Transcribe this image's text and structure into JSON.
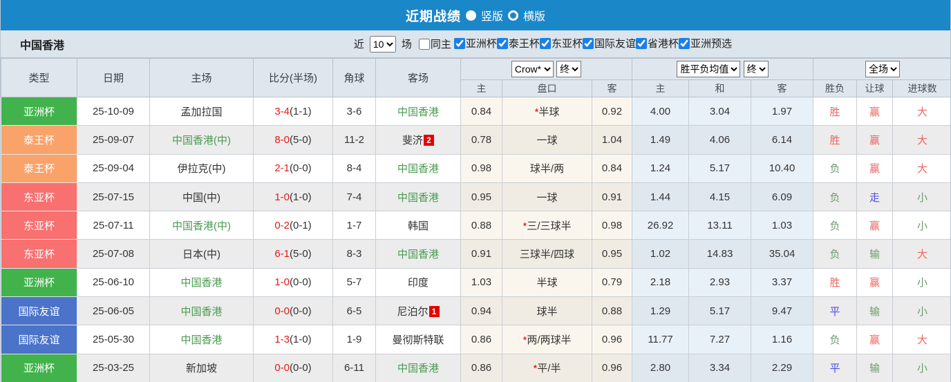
{
  "title_bar": {
    "title": "近期战绩",
    "radios": [
      {
        "label": "竖版",
        "selected": true
      },
      {
        "label": "横版",
        "selected": false
      }
    ]
  },
  "filter": {
    "team": "中国香港",
    "near_label": "近",
    "match_count": "10",
    "matches_label": "场",
    "same_home": {
      "label": "同主",
      "checked": false
    },
    "competitions": [
      {
        "label": "亚洲杯",
        "checked": true
      },
      {
        "label": "泰王杯",
        "checked": true
      },
      {
        "label": "东亚杯",
        "checked": true
      },
      {
        "label": "国际友谊",
        "checked": true
      },
      {
        "label": "省港杯",
        "checked": true
      },
      {
        "label": "亚洲预选",
        "checked": true
      }
    ]
  },
  "table": {
    "headers": {
      "type": "类型",
      "date": "日期",
      "home": "主场",
      "score": "比分(半场)",
      "corners": "角球",
      "away": "客场"
    },
    "selects": {
      "odds_source": "Crow*",
      "odds_time": "终",
      "avg_source": "胜平负均值",
      "avg_time": "终",
      "scope": "全场"
    },
    "sub_headers": {
      "odds_home": "主",
      "odds_line": "盘口",
      "odds_away": "客",
      "avg_home": "主",
      "avg_draw": "和",
      "avg_away": "客",
      "outcome": "胜负",
      "handicap": "让球",
      "goals": "进球数"
    },
    "highlight_team": "中国香港",
    "type_colors": {
      "亚洲杯": "#42b34c",
      "泰王杯": "#f9a36b",
      "东亚杯": "#f97070",
      "国际友谊": "#4a73c9"
    },
    "result_colors": {
      "胜": "red",
      "负": "green",
      "平": "blue",
      "赢": "red",
      "输": "green",
      "走": "blue",
      "大": "red",
      "小": "green"
    },
    "rows": [
      {
        "type": "亚洲杯",
        "date": "25-10-09",
        "home": "孟加拉国",
        "score_ft": "3-4",
        "score_ht": "(1-1)",
        "corners": "3-6",
        "away": "中国香港",
        "away_badge": "",
        "odds_home": "0.84",
        "line": "*半球",
        "odds_away": "0.92",
        "avg_home": "4.00",
        "avg_draw": "3.04",
        "avg_away": "1.97",
        "outcome": "胜",
        "handicap": "赢",
        "goals": "大"
      },
      {
        "type": "泰王杯",
        "date": "25-09-07",
        "home": "中国香港(中)",
        "score_ft": "8-0",
        "score_ht": "(5-0)",
        "corners": "11-2",
        "away": "斐济",
        "away_badge": "2",
        "odds_home": "0.78",
        "line": "一球",
        "odds_away": "1.04",
        "avg_home": "1.49",
        "avg_draw": "4.06",
        "avg_away": "6.14",
        "outcome": "胜",
        "handicap": "赢",
        "goals": "大"
      },
      {
        "type": "泰王杯",
        "date": "25-09-04",
        "home": "伊拉克(中)",
        "score_ft": "2-1",
        "score_ht": "(0-0)",
        "corners": "8-4",
        "away": "中国香港",
        "away_badge": "",
        "odds_home": "0.98",
        "line": "球半/两",
        "odds_away": "0.84",
        "avg_home": "1.24",
        "avg_draw": "5.17",
        "avg_away": "10.40",
        "outcome": "负",
        "handicap": "赢",
        "goals": "大"
      },
      {
        "type": "东亚杯",
        "date": "25-07-15",
        "home": "中国(中)",
        "score_ft": "1-0",
        "score_ht": "(1-0)",
        "corners": "7-4",
        "away": "中国香港",
        "away_badge": "",
        "odds_home": "0.95",
        "line": "一球",
        "odds_away": "0.91",
        "avg_home": "1.44",
        "avg_draw": "4.15",
        "avg_away": "6.09",
        "outcome": "负",
        "handicap": "走",
        "goals": "小"
      },
      {
        "type": "东亚杯",
        "date": "25-07-11",
        "home": "中国香港(中)",
        "score_ft": "0-2",
        "score_ht": "(0-1)",
        "corners": "1-7",
        "away": "韩国",
        "away_badge": "",
        "odds_home": "0.88",
        "line": "*三/三球半",
        "odds_away": "0.98",
        "avg_home": "26.92",
        "avg_draw": "13.11",
        "avg_away": "1.03",
        "outcome": "负",
        "handicap": "赢",
        "goals": "小"
      },
      {
        "type": "东亚杯",
        "date": "25-07-08",
        "home": "日本(中)",
        "score_ft": "6-1",
        "score_ht": "(5-0)",
        "corners": "8-3",
        "away": "中国香港",
        "away_badge": "",
        "odds_home": "0.91",
        "line": "三球半/四球",
        "odds_away": "0.95",
        "avg_home": "1.02",
        "avg_draw": "14.83",
        "avg_away": "35.04",
        "outcome": "负",
        "handicap": "输",
        "goals": "大"
      },
      {
        "type": "亚洲杯",
        "date": "25-06-10",
        "home": "中国香港",
        "score_ft": "1-0",
        "score_ht": "(0-0)",
        "corners": "5-7",
        "away": "印度",
        "away_badge": "",
        "odds_home": "1.03",
        "line": "半球",
        "odds_away": "0.79",
        "avg_home": "2.18",
        "avg_draw": "2.93",
        "avg_away": "3.37",
        "outcome": "胜",
        "handicap": "赢",
        "goals": "小"
      },
      {
        "type": "国际友谊",
        "date": "25-06-05",
        "home": "中国香港",
        "score_ft": "0-0",
        "score_ht": "(0-0)",
        "corners": "6-5",
        "away": "尼泊尔",
        "away_badge": "1",
        "odds_home": "0.94",
        "line": "球半",
        "odds_away": "0.88",
        "avg_home": "1.29",
        "avg_draw": "5.17",
        "avg_away": "9.47",
        "outcome": "平",
        "handicap": "输",
        "goals": "小"
      },
      {
        "type": "国际友谊",
        "date": "25-05-30",
        "home": "中国香港",
        "score_ft": "1-3",
        "score_ht": "(1-0)",
        "corners": "1-9",
        "away": "曼彻斯特联",
        "away_badge": "",
        "odds_home": "0.86",
        "line": "*两/两球半",
        "odds_away": "0.96",
        "avg_home": "11.77",
        "avg_draw": "7.27",
        "avg_away": "1.16",
        "outcome": "负",
        "handicap": "赢",
        "goals": "大"
      },
      {
        "type": "亚洲杯",
        "date": "25-03-25",
        "home": "新加坡",
        "score_ft": "0-0",
        "score_ht": "(0-0)",
        "corners": "6-11",
        "away": "中国香港",
        "away_badge": "",
        "odds_home": "0.86",
        "line": "*平/半",
        "odds_away": "0.96",
        "avg_home": "2.80",
        "avg_draw": "3.34",
        "avg_away": "2.29",
        "outcome": "平",
        "handicap": "输",
        "goals": "小"
      }
    ]
  }
}
